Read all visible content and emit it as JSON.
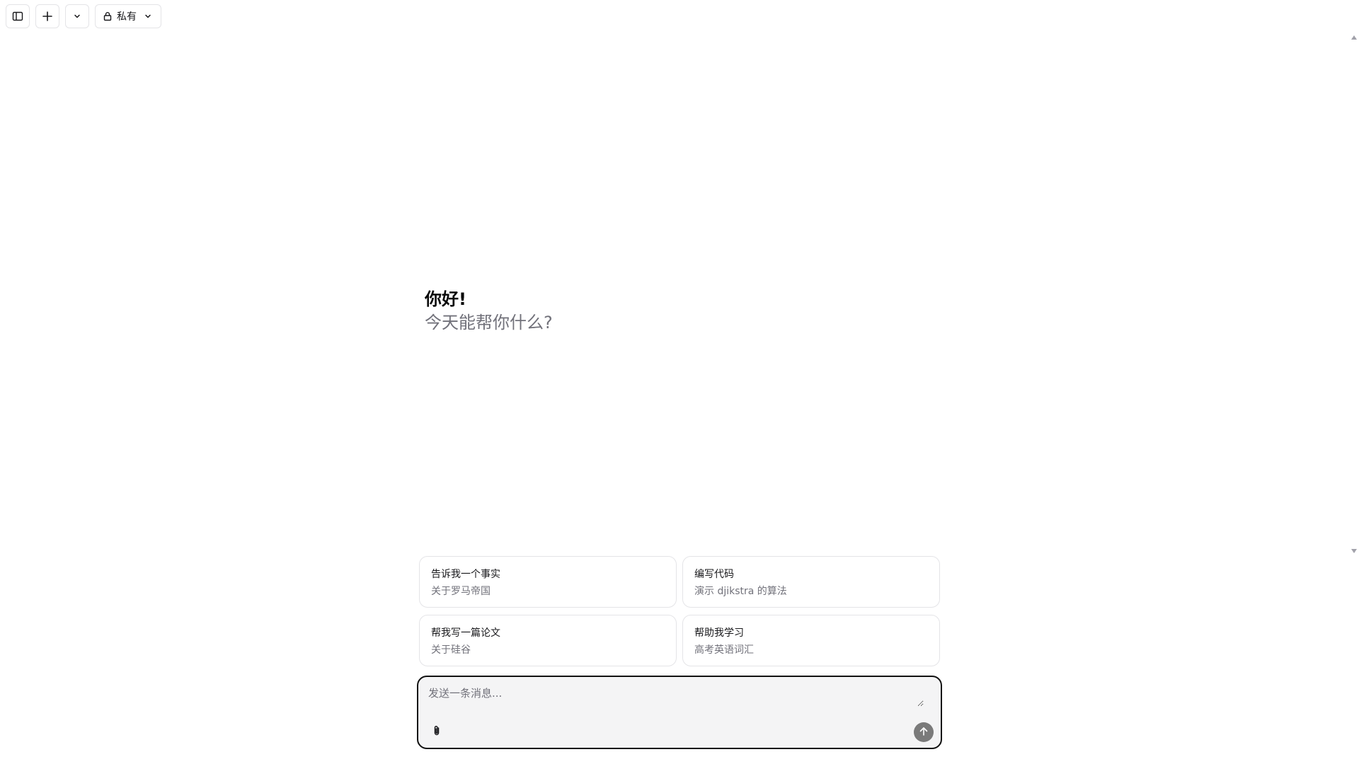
{
  "toolbar": {
    "sidebar_toggle_icon": "sidebar-icon",
    "new_chat_icon": "plus-icon",
    "model_menu_icon": "chevron-down-icon",
    "visibility_icon": "lock-icon",
    "visibility_label": "私有"
  },
  "greeting": {
    "title": "你好!",
    "subtitle": "今天能帮你什么?"
  },
  "suggestions": [
    {
      "title": "告诉我一个事实",
      "subtitle": "关于罗马帝国"
    },
    {
      "title": "编写代码",
      "subtitle": "演示 djikstra 的算法"
    },
    {
      "title": "帮我写一篇论文",
      "subtitle": "关于硅谷"
    },
    {
      "title": "帮助我学习",
      "subtitle": "高考英语词汇"
    }
  ],
  "composer": {
    "placeholder": "发送一条消息...",
    "value": "",
    "attach_icon": "paperclip-icon",
    "send_icon": "arrow-up-icon"
  },
  "colors": {
    "border": "#e4e4e7",
    "muted_text": "#71717a",
    "composer_bg": "#f4f4f5",
    "send_button": "#7a7a7a"
  }
}
